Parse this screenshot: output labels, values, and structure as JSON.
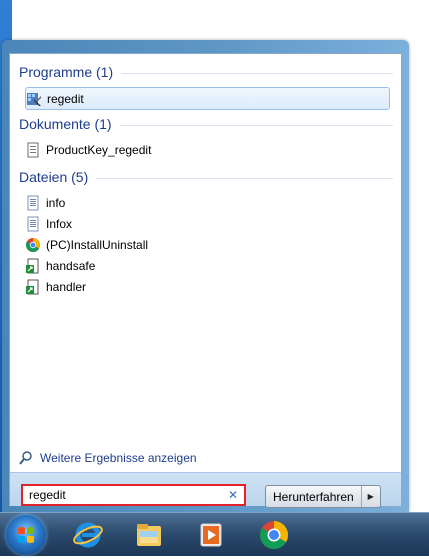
{
  "sections": {
    "programs": {
      "title": "Programme (1)",
      "items": [
        {
          "label": "regedit",
          "icon": "regedit-icon"
        }
      ]
    },
    "documents": {
      "title": "Dokumente (1)",
      "items": [
        {
          "label": "ProductKey_regedit",
          "icon": "document-icon"
        }
      ]
    },
    "files": {
      "title": "Dateien (5)",
      "items": [
        {
          "label": "info",
          "icon": "text-file-icon"
        },
        {
          "label": "Infox",
          "icon": "text-file-icon"
        },
        {
          "label": "(PC)InstallUninstall",
          "icon": "chrome-icon"
        },
        {
          "label": "handsafe",
          "icon": "shortcut-icon"
        },
        {
          "label": "handler",
          "icon": "shortcut-icon"
        }
      ]
    }
  },
  "more_results": {
    "label": "Weitere Ergebnisse anzeigen",
    "icon": "magnifier-icon"
  },
  "search": {
    "value": "regedit",
    "clear_icon": "close-icon"
  },
  "shutdown": {
    "label": "Herunterfahren",
    "arrow_icon": "triangle-right-icon"
  },
  "taskbar": {
    "icons": [
      "windows-start-orb",
      "internet-explorer-icon",
      "file-explorer-icon",
      "media-player-icon",
      "chrome-icon"
    ]
  },
  "colors": {
    "section_title": "#1e3d8f",
    "highlight_border": "#9cc0e8",
    "search_border": "#e0222b"
  }
}
